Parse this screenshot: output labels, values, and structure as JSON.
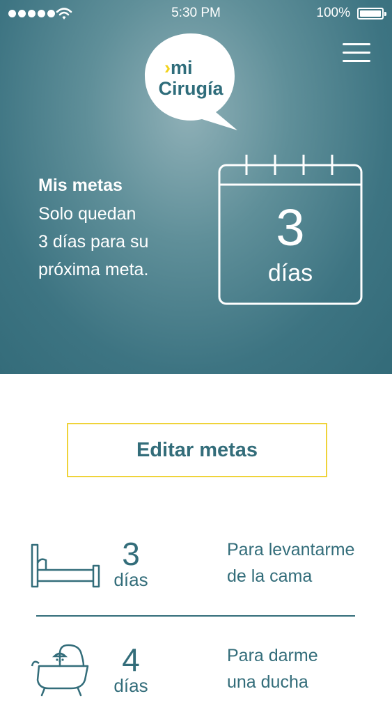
{
  "status_bar": {
    "time": "5:30 PM",
    "battery": "100%"
  },
  "logo": {
    "line1_prefix": "›",
    "line1": "mi",
    "line2": "Cirugía"
  },
  "hero": {
    "title": "Mis metas",
    "line1": "Solo quedan",
    "line2": "3 días para su",
    "line3": "próxima meta.",
    "countdown_value": "3",
    "countdown_unit": "días"
  },
  "edit_button": {
    "label": "Editar metas"
  },
  "goals": [
    {
      "icon": "bed-icon",
      "value": "3",
      "unit": "días",
      "desc_line1": "Para levantarme",
      "desc_line2": "de la cama"
    },
    {
      "icon": "bathtub-icon",
      "value": "4",
      "unit": "días",
      "desc_line1": "Para darme",
      "desc_line2": "una ducha"
    }
  ],
  "colors": {
    "brand_teal": "#336d7a",
    "accent_yellow": "#efd33a"
  }
}
